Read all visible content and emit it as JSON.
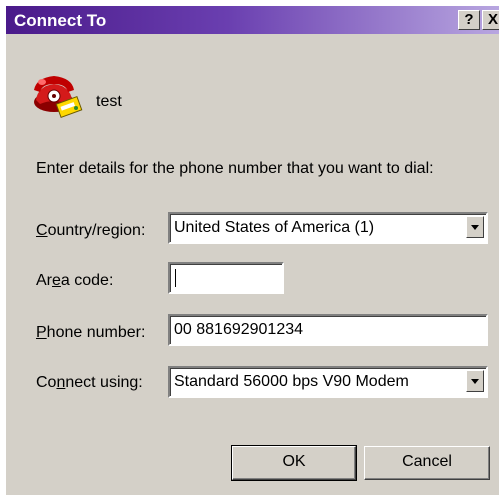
{
  "window": {
    "title": "Connect To",
    "help_button": "?",
    "close_button": "X"
  },
  "connection": {
    "name": "test",
    "icon": "phone-icon"
  },
  "instructions": "Enter details for the phone number that you want to dial:",
  "fields": {
    "country": {
      "label_prefix": "",
      "label_mnemonic": "C",
      "label_rest": "ountry/region:",
      "value": "United States of America (1)"
    },
    "area_code": {
      "label_prefix": "Ar",
      "label_mnemonic": "e",
      "label_rest": "a code:",
      "value": ""
    },
    "phone_number": {
      "label_prefix": "",
      "label_mnemonic": "P",
      "label_rest": "hone number:",
      "value": "00 881692901234"
    },
    "connect_using": {
      "label_prefix": "Co",
      "label_mnemonic": "n",
      "label_rest": "nect using:",
      "value": "Standard 56000 bps V90 Modem"
    }
  },
  "buttons": {
    "ok": "OK",
    "cancel": "Cancel"
  },
  "colors": {
    "titlebar_start": "#4a1a8a",
    "titlebar_end": "#b8a6e0",
    "dialog_face": "#d4d0c8"
  }
}
